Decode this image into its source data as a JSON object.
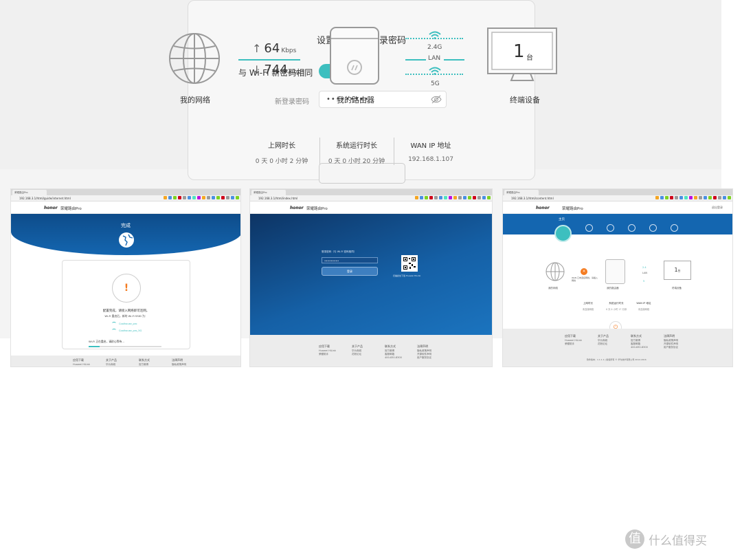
{
  "panel1": {
    "title": "设置路由器的登录密码",
    "toggle_label": "与 Wi-Fi 新密码相同",
    "toggle_on": true,
    "password_label": "新登录密码",
    "password_value": "•••••••••"
  },
  "browser": {
    "tab_title": "荣耀路由Pro",
    "logo": "honor",
    "brand": "荣耀路由Pro",
    "accent": "#3dbfbf",
    "header_blue": "#1466b0"
  },
  "screen1": {
    "url": "192.168.3.1/html/guide/internet.html",
    "heading": "完成",
    "warn_symbol": "!",
    "config_text": "配置完成，请接入网络即可连网。",
    "ssid_text": "Wi-Fi 重启后，新的 Wi-Fi SSID 为：",
    "networks": [
      "Coolhouse_pro",
      "Coolhouse_pro_5G"
    ],
    "restart_text": "Wi-Fi 正在重启，请耐心等待...",
    "progress": 0.15,
    "footer_cols": [
      "应用下载",
      "关于产品",
      "联系方式",
      "法律声明"
    ],
    "footer_items": [
      [
        "Huawei HiLink"
      ],
      [
        "华为商城"
      ],
      [
        "官方微博"
      ],
      [
        "隐私政策声明"
      ]
    ]
  },
  "screen2": {
    "url": "192.168.3.1/html/index.html",
    "login_label": "登录密码（与 Wi-Fi 密码相同）",
    "password_value": "•••••••••",
    "login_button": "登录",
    "qr_caption": "扫描此处下载 Huawei HiLink",
    "footer_cols": [
      "应用下载",
      "关于产品",
      "联系方式",
      "法律声明"
    ],
    "footer_items": [
      [
        "Huawei HiLink",
        "荣耀助手"
      ],
      [
        "华为商城",
        "花粉论坛"
      ],
      [
        "官方微博",
        "客服邮箱",
        "400-830-8300"
      ],
      [
        "隐私政策声明",
        "开源软件声明",
        "用户服务协议"
      ]
    ]
  },
  "screen3": {
    "url": "192.168.3.1/html/content.html",
    "header_link": "退出登录",
    "home_label": "主页",
    "nav_icons": [
      "globe-icon",
      "wifi-icon",
      "settings-icon",
      "user-icon",
      "menu-icon"
    ],
    "my_network": "我的网络",
    "error_text": "WAN 口未连接网线，请插入网线",
    "my_router": "我的路由器",
    "terminal": "终端设备",
    "device_count": "1",
    "device_unit": "台",
    "band_24": "2.4",
    "band_lan": "LAN",
    "band_5": "5",
    "stats": [
      {
        "label": "上网时长",
        "value": "未连接网络"
      },
      {
        "label": "系统运行时长",
        "value": "0 天 0 小时 17 分钟"
      },
      {
        "label": "WAN IP 地址",
        "value": "未连接网络"
      }
    ],
    "footer_cols": [
      "应用下载",
      "关于产品",
      "联系方式",
      "法律声明"
    ],
    "footer_items": [
      [
        "Huawei HiLink",
        "荣耀助手"
      ],
      [
        "华为商城",
        "花粉论坛"
      ],
      [
        "官方微博",
        "客服邮箱",
        "400-830-8300"
      ],
      [
        "隐私政策声明",
        "开源软件声明",
        "用户服务协议"
      ]
    ],
    "copyright": "软件版本：1.1.1.1 | 版权所有 © 华为技术有限公司 2012-2016"
  },
  "panel3": {
    "upload_value": "64",
    "upload_unit": "Kbps",
    "download_value": "744",
    "download_unit": "Kbps",
    "band_24": "2.4G",
    "band_lan": "LAN",
    "band_5": "5G",
    "device_count": "1",
    "device_unit": "台",
    "my_network": "我的网络",
    "my_router": "我的路由器",
    "terminal": "终端设备",
    "stats": [
      {
        "label": "上网时长",
        "value": "0 天 0 小时 2 分钟"
      },
      {
        "label": "系统运行时长",
        "value": "0 天 0 小时 20 分钟"
      },
      {
        "label": "WAN IP 地址",
        "value": "192.168.1.107"
      }
    ]
  },
  "watermark": {
    "badge": "值",
    "text": "什么值得买"
  }
}
